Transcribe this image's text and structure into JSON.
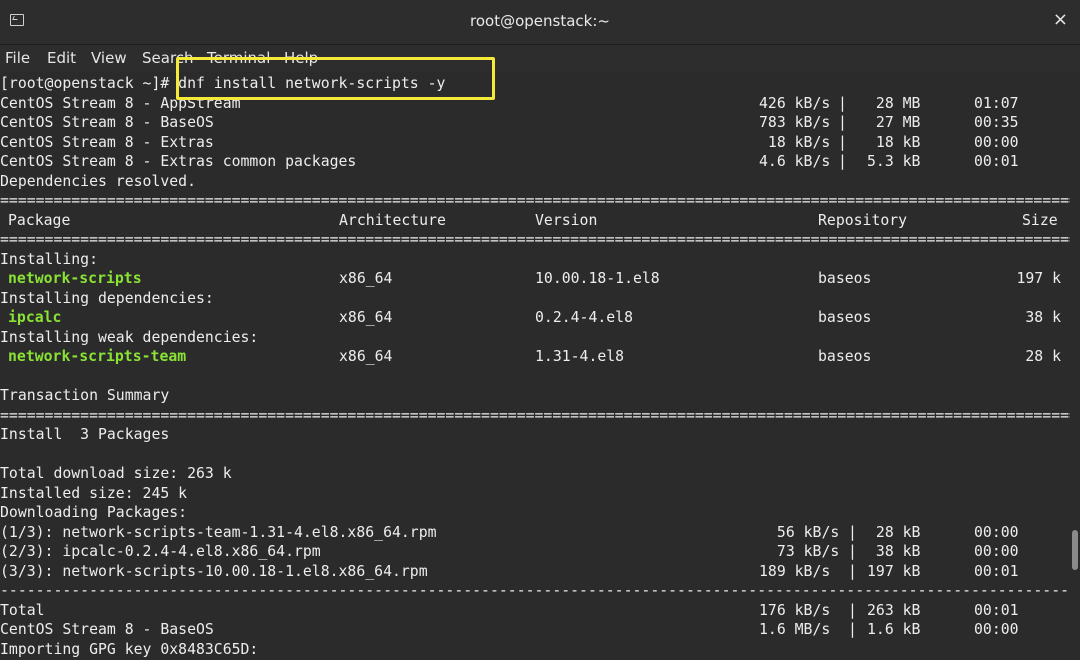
{
  "window": {
    "title": "root@openstack:~",
    "close_label": "×"
  },
  "menu": [
    "File",
    "Edit",
    "View",
    "Search",
    "Terminal",
    "Help"
  ],
  "prompt": {
    "text": "[root@openstack ~]# ",
    "command": "dnf install network-scripts -y"
  },
  "repo_lines": [
    {
      "name": "CentOS Stream 8 - AppStream",
      "speed": "426 kB/s",
      "size": " 28 MB",
      "time": "01:07"
    },
    {
      "name": "CentOS Stream 8 - BaseOS",
      "speed": "783 kB/s",
      "size": " 27 MB",
      "time": "00:35"
    },
    {
      "name": "CentOS Stream 8 - Extras",
      "speed": " 18 kB/s",
      "size": " 18 kB",
      "time": "00:00"
    },
    {
      "name": "CentOS Stream 8 - Extras common packages",
      "speed": "4.6 kB/s",
      "size": "5.3 kB",
      "time": "00:01"
    }
  ],
  "deps_resolved": "Dependencies resolved.",
  "table_header": {
    "package": "Package",
    "arch": "Architecture",
    "version": "Version",
    "repo": "Repository",
    "size": "Size"
  },
  "groups": [
    {
      "heading": "Installing:",
      "pkg": "network-scripts",
      "arch": "x86_64",
      "version": "10.00.18-1.el8",
      "repo": "baseos",
      "size": "197 k"
    },
    {
      "heading": "Installing dependencies:",
      "pkg": "ipcalc",
      "arch": "x86_64",
      "version": "0.2.4-4.el8",
      "repo": "baseos",
      "size": "38 k"
    },
    {
      "heading": "Installing weak dependencies:",
      "pkg": "network-scripts-team",
      "arch": "x86_64",
      "version": "1.31-4.el8",
      "repo": "baseos",
      "size": "28 k"
    }
  ],
  "transaction_summary": "Transaction Summary",
  "install_line": "Install  3 Packages",
  "total_download": "Total download size: 263 k",
  "installed_size": "Installed size: 245 k",
  "downloading": "Downloading Packages:",
  "downloads": [
    {
      "name": "(1/3): network-scripts-team-1.31-4.el8.x86_64.rpm",
      "speed": " 56 kB/s",
      "size": " 28 kB",
      "time": "00:00"
    },
    {
      "name": "(2/3): ipcalc-0.2.4-4.el8.x86_64.rpm",
      "speed": " 73 kB/s",
      "size": " 38 kB",
      "time": "00:00"
    },
    {
      "name": "(3/3): network-scripts-10.00.18-1.el8.x86_64.rpm",
      "speed": "189 kB/s",
      "size": "197 kB",
      "time": "00:01"
    }
  ],
  "total_line": {
    "name": "Total",
    "speed": "176 kB/s",
    "size": "263 kB",
    "time": "00:01"
  },
  "baseos_line": {
    "name": "CentOS Stream 8 - BaseOS",
    "speed": "1.6 MB/s",
    "size": "1.6 kB",
    "time": "00:00"
  },
  "gpg_line": "Importing GPG key 0x8483C65D:",
  "colors": {
    "background": "#2b2b2b",
    "text": "#ededed",
    "package_green": "#8ae234",
    "highlight": "#f5ea3a"
  }
}
